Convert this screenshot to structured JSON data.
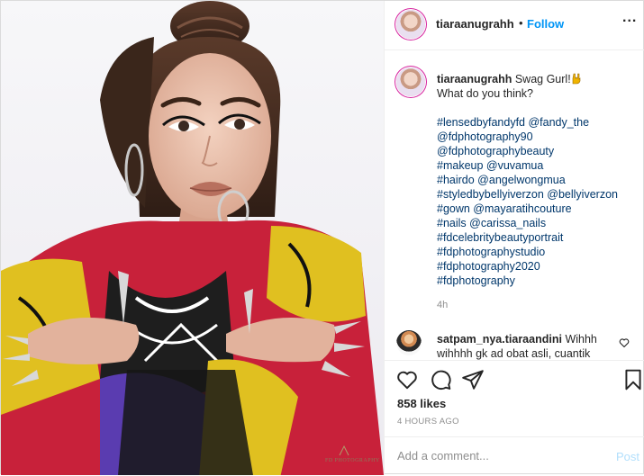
{
  "post": {
    "author": "tiaraanugrahh",
    "follow_separator": "•",
    "follow_label": "Follow",
    "more_glyph": "...",
    "caption": {
      "username": "tiaraanugrahh",
      "first_line": "Swag Gurl!",
      "emoji": "rock-on-hand",
      "second_line": "What do you think?",
      "tags": [
        "#lensedbyfandyfd @fandy_the",
        "@fdphotography90",
        "@fdphotographybeauty",
        "#makeup @vuvamua",
        "#hairdo @angelwongmua",
        "#styledbybellyiverzon @bellyiverzon",
        "#gown @mayaratihcouture",
        "#nails @carissa_nails",
        "#fdcelebritybeautyportrait",
        "#fdphotographystudio",
        "#fdphotography2020",
        "#fdphotography"
      ],
      "time_ago": "4h"
    },
    "comment": {
      "username": "satpam_nya.tiaraandini",
      "text": "Wihhh wihhhh gk ad obat asli, cuantik"
    },
    "likes": "858 likes",
    "date": "4 HOURS AGO",
    "add_comment_placeholder": "Add a comment...",
    "post_button": "Post",
    "watermark": "FD PHOTOGRAPHY"
  },
  "icons": {
    "like": "heart-outline-icon",
    "comment": "speech-bubble-icon",
    "share": "paper-plane-icon",
    "save": "bookmark-icon",
    "comment_like": "small-heart-icon"
  },
  "colors": {
    "link_blue": "#0095f6",
    "hashtag": "#00376b",
    "muted": "#8e8e8e",
    "post_button_disabled": "#b2dffc",
    "story_ring": "#d6249f"
  }
}
